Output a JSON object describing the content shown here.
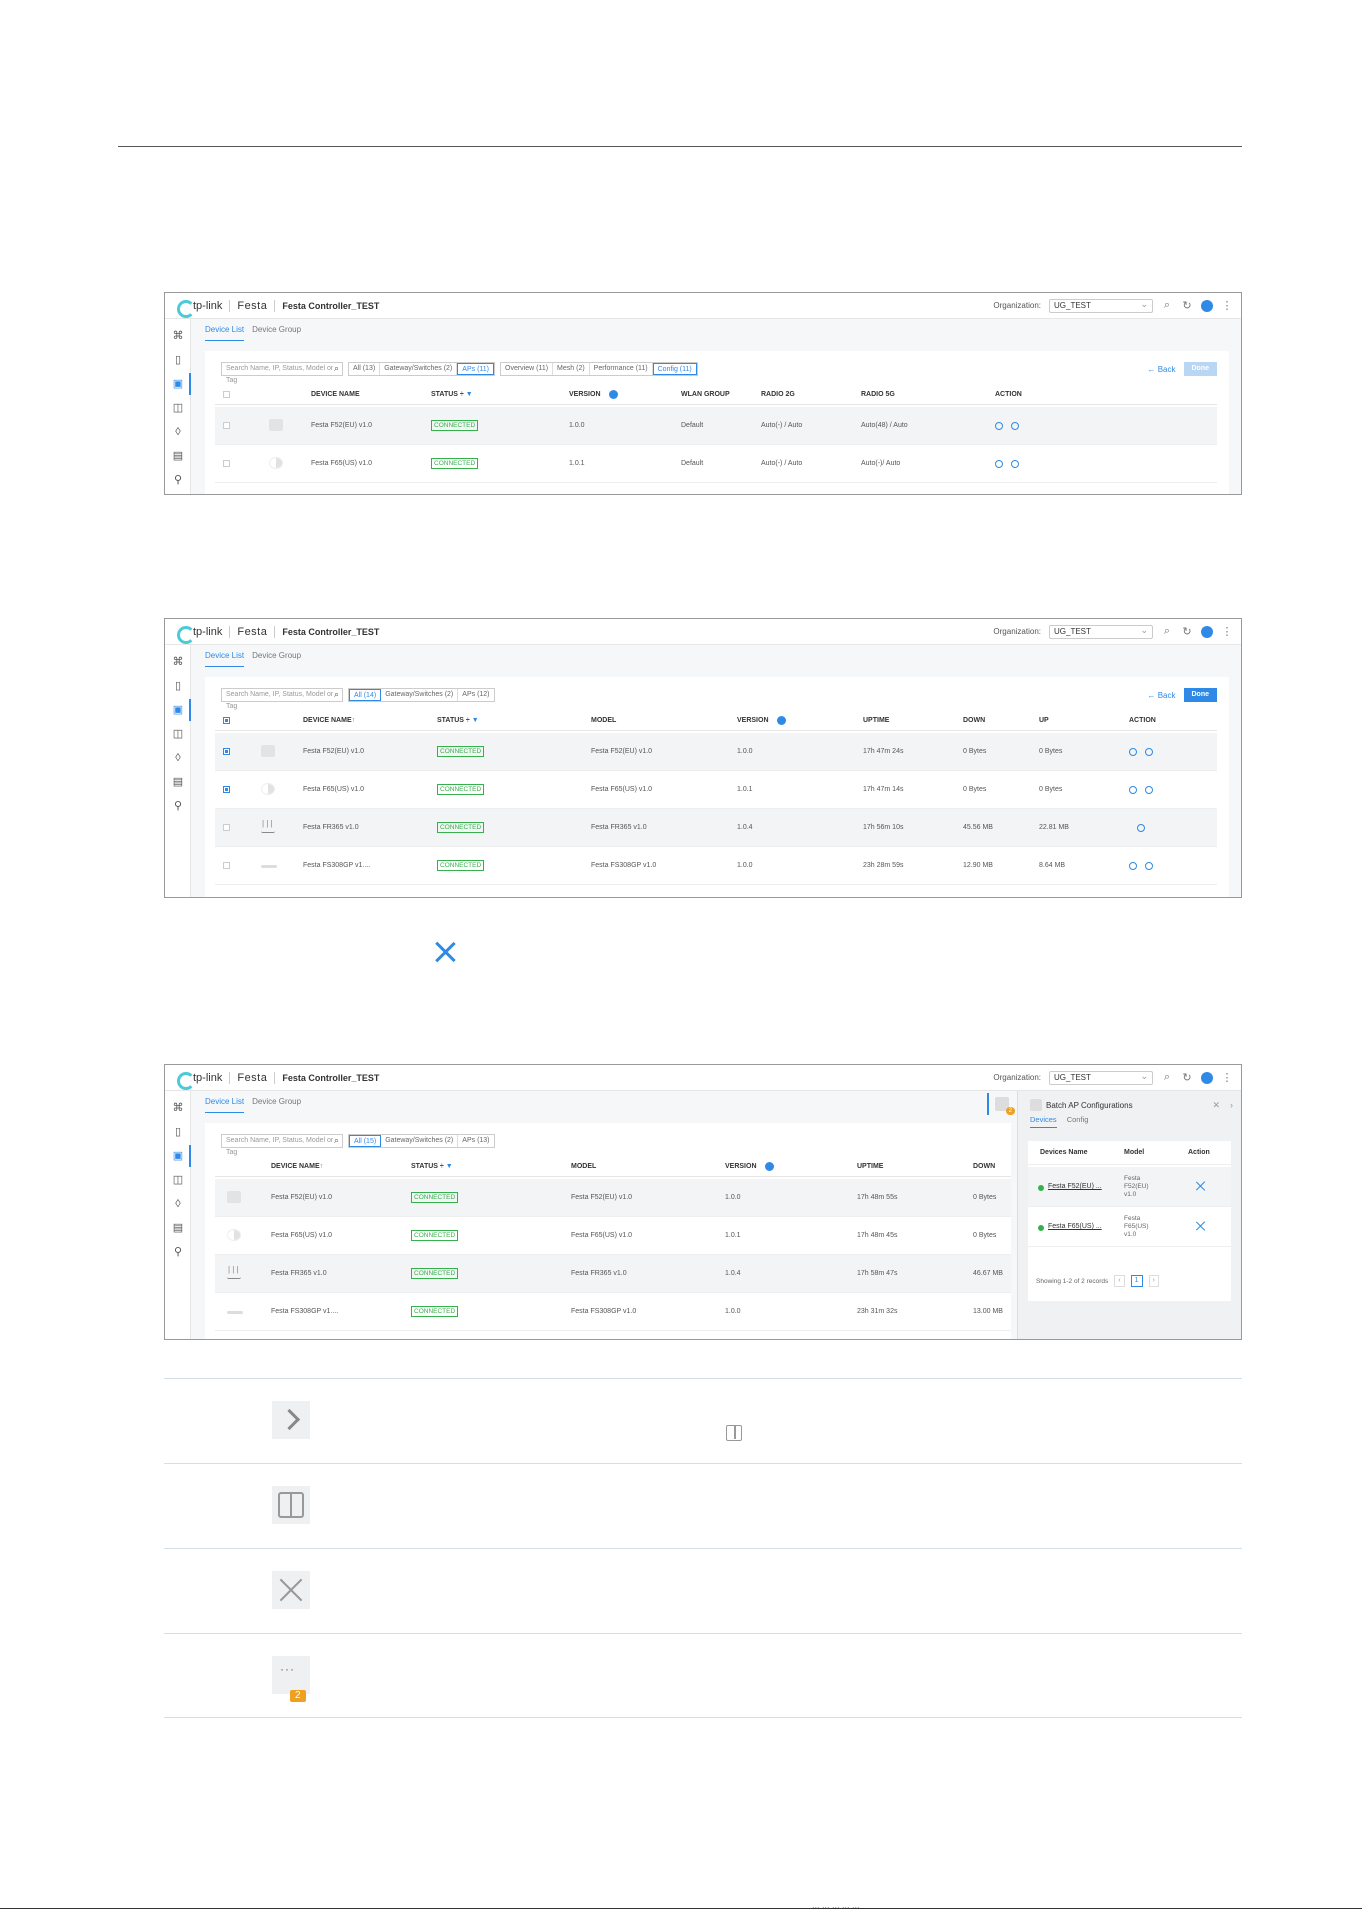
{
  "footer": {
    "text": "... ... ... ... ..."
  },
  "shots": [
    {
      "header": {
        "logo": "tp-link",
        "brand": "Festa",
        "controller": "Festa Controller_TEST",
        "org_label": "Organization:",
        "org_value": "UG_TEST"
      },
      "tabs": [
        "Device List",
        "Device Group"
      ],
      "search_placeholder": "Search Name, IP, Status, Model or Tag",
      "filters": [
        "All (13)",
        "Gateway/Switches (2)",
        "APs (11)"
      ],
      "views": [
        "Overview (11)",
        "Mesh (2)",
        "Performance (11)",
        "Config (11)"
      ],
      "back": "← Back",
      "done": "Done",
      "columns": [
        "DEVICE NAME",
        "STATUS ÷",
        "VERSION",
        "WLAN GROUP",
        "RADIO 2G",
        "RADIO 5G",
        "ACTION"
      ],
      "rows": [
        {
          "name": "Festa F52(EU) v1.0",
          "status": "CONNECTED",
          "version": "1.0.0",
          "wlan": "Default",
          "r2g": "Auto(-) / Auto",
          "r5g": "Auto(48) / Auto"
        },
        {
          "name": "Festa F65(US) v1.0",
          "status": "CONNECTED",
          "version": "1.0.1",
          "wlan": "Default",
          "r2g": "Auto(-) / Auto",
          "r5g": "Auto(-)/ Auto"
        }
      ]
    },
    {
      "header": {
        "logo": "tp-link",
        "brand": "Festa",
        "controller": "Festa Controller_TEST",
        "org_label": "Organization:",
        "org_value": "UG_TEST"
      },
      "tabs": [
        "Device List",
        "Device Group"
      ],
      "search_placeholder": "Search Name, IP, Status, Model or Tag",
      "filters": [
        "All (14)",
        "Gateway/Switches (2)",
        "APs (12)"
      ],
      "back": "← Back",
      "done": "Done",
      "columns": [
        "DEVICE NAME",
        "STATUS ÷",
        "MODEL",
        "VERSION",
        "UPTIME",
        "DOWN",
        "UP",
        "ACTION"
      ],
      "rows": [
        {
          "name": "Festa F52(EU) v1.0",
          "status": "CONNECTED",
          "model": "Festa F52(EU) v1.0",
          "version": "1.0.0",
          "uptime": "17h 47m 24s",
          "down": "0 Bytes",
          "up": "0 Bytes"
        },
        {
          "name": "Festa F65(US) v1.0",
          "status": "CONNECTED",
          "model": "Festa F65(US) v1.0",
          "version": "1.0.1",
          "uptime": "17h 47m 14s",
          "down": "0 Bytes",
          "up": "0 Bytes"
        },
        {
          "name": "Festa FR365 v1.0",
          "status": "CONNECTED",
          "model": "Festa FR365 v1.0",
          "version": "1.0.4",
          "uptime": "17h 56m 10s",
          "down": "45.56 MB",
          "up": "22.81 MB"
        },
        {
          "name": "Festa FS308GP v1....",
          "status": "CONNECTED",
          "model": "Festa FS308GP v1.0",
          "version": "1.0.0",
          "uptime": "23h 28m 59s",
          "down": "12.90 MB",
          "up": "8.64 MB"
        }
      ]
    },
    {
      "header": {
        "logo": "tp-link",
        "brand": "Festa",
        "controller": "Festa Controller_TEST",
        "org_label": "Organization:",
        "org_value": "UG_TEST"
      },
      "tabs": [
        "Device List",
        "Device Group"
      ],
      "search_placeholder": "Search Name, IP, Status, Model or Tag",
      "filters": [
        "All (15)",
        "Gateway/Switches (2)",
        "APs (13)"
      ],
      "columns": [
        "DEVICE NAME",
        "STATUS ÷",
        "MODEL",
        "VERSION",
        "UPTIME",
        "DOWN"
      ],
      "rows": [
        {
          "name": "Festa F52(EU) v1.0",
          "status": "CONNECTED",
          "model": "Festa F52(EU) v1.0",
          "version": "1.0.0",
          "uptime": "17h 48m 55s",
          "down": "0 Bytes"
        },
        {
          "name": "Festa F65(US) v1.0",
          "status": "CONNECTED",
          "model": "Festa F65(US) v1.0",
          "version": "1.0.1",
          "uptime": "17h 48m 45s",
          "down": "0 Bytes"
        },
        {
          "name": "Festa FR365 v1.0",
          "status": "CONNECTED",
          "model": "Festa FR365 v1.0",
          "version": "1.0.4",
          "uptime": "17h 58m 47s",
          "down": "46.67 MB"
        },
        {
          "name": "Festa FS308GP v1....",
          "status": "CONNECTED",
          "model": "Festa FS308GP v1.0",
          "version": "1.0.0",
          "uptime": "23h 31m 32s",
          "down": "13.00 MB"
        }
      ],
      "notify_count": "2",
      "drawer": {
        "title": "Batch AP Configurations",
        "tabs": [
          "Devices",
          "Config"
        ],
        "columns": [
          "Devices Name",
          "Model",
          "Action"
        ],
        "rows": [
          {
            "name": "Festa F52(EU) ...",
            "model": "Festa F52(EU) v1.0"
          },
          {
            "name": "Festa F65(US) ...",
            "model": "Festa F65(US) v1.0"
          }
        ],
        "footer": "Showing 1-2 of 2 records",
        "page": "1",
        "prev": "‹",
        "next": "›"
      }
    }
  ],
  "legend": {
    "badge": "2"
  }
}
